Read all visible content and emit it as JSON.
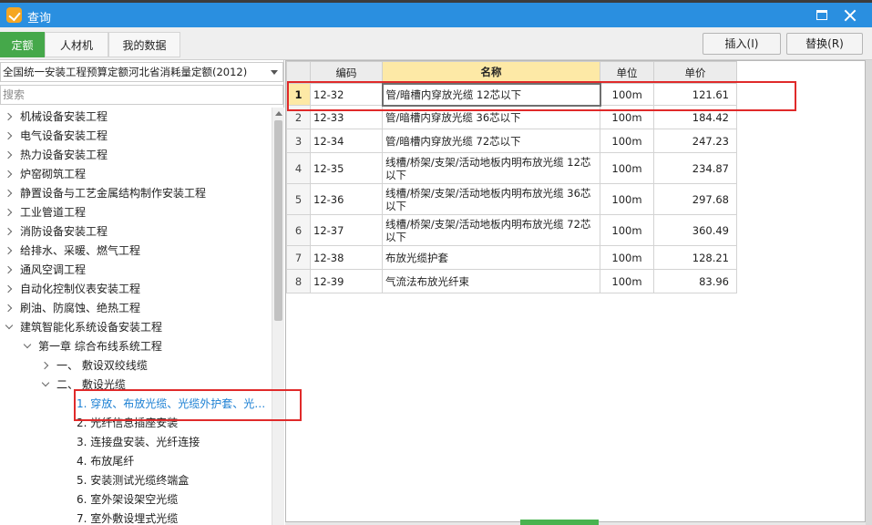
{
  "window": {
    "title": "查询"
  },
  "tabs": [
    {
      "label": "定额",
      "active": true
    },
    {
      "label": "人材机"
    },
    {
      "label": "我的数据"
    }
  ],
  "buttons": {
    "insert": "插入(I)",
    "replace": "替换(R)"
  },
  "quota_library": "全国统一安装工程预算定额河北省消耗量定额(2012)",
  "search": {
    "placeholder": "搜索"
  },
  "tree": [
    {
      "label": "机械设备安装工程",
      "level": 0,
      "expander": "right"
    },
    {
      "label": "电气设备安装工程",
      "level": 0,
      "expander": "right"
    },
    {
      "label": "热力设备安装工程",
      "level": 0,
      "expander": "right"
    },
    {
      "label": "炉窑砌筑工程",
      "level": 0,
      "expander": "right"
    },
    {
      "label": "静置设备与工艺金属结构制作安装工程",
      "level": 0,
      "expander": "right"
    },
    {
      "label": "工业管道工程",
      "level": 0,
      "expander": "right"
    },
    {
      "label": "消防设备安装工程",
      "level": 0,
      "expander": "right"
    },
    {
      "label": "给排水、采暖、燃气工程",
      "level": 0,
      "expander": "right"
    },
    {
      "label": "通风空调工程",
      "level": 0,
      "expander": "right"
    },
    {
      "label": "自动化控制仪表安装工程",
      "level": 0,
      "expander": "right"
    },
    {
      "label": "刷油、防腐蚀、绝热工程",
      "level": 0,
      "expander": "right"
    },
    {
      "label": "建筑智能化系统设备安装工程",
      "level": 0,
      "expander": "down"
    },
    {
      "label": "第一章 综合布线系统工程",
      "level": 1,
      "expander": "down"
    },
    {
      "label": "一、 敷设双绞线缆",
      "level": 2,
      "expander": "right"
    },
    {
      "label": "二、 敷设光缆",
      "level": 2,
      "expander": "down"
    },
    {
      "label": "1.  穿放、布放光缆、光缆外护套、光…",
      "level": 3,
      "expander": "none",
      "selected": true
    },
    {
      "label": "2.  光纤信息插座安装",
      "level": 3,
      "expander": "none"
    },
    {
      "label": "3.  连接盘安装、光纤连接",
      "level": 3,
      "expander": "none"
    },
    {
      "label": "4.  布放尾纤",
      "level": 3,
      "expander": "none"
    },
    {
      "label": "5.  安装测试光缆终端盒",
      "level": 3,
      "expander": "none"
    },
    {
      "label": "6.  室外架设架空光缆",
      "level": 3,
      "expander": "none"
    },
    {
      "label": "7.  室外敷设埋式光缆",
      "level": 3,
      "expander": "none"
    }
  ],
  "table": {
    "headers": [
      "",
      "编码",
      "名称",
      "单位",
      "单价"
    ],
    "rows": [
      {
        "index": "1",
        "code": "12-32",
        "name": "管/暗槽内穿放光缆 12芯以下",
        "unit": "100m",
        "price": "121.61"
      },
      {
        "index": "2",
        "code": "12-33",
        "name": "管/暗槽内穿放光缆 36芯以下",
        "unit": "100m",
        "price": "184.42"
      },
      {
        "index": "3",
        "code": "12-34",
        "name": "管/暗槽内穿放光缆 72芯以下",
        "unit": "100m",
        "price": "247.23"
      },
      {
        "index": "4",
        "code": "12-35",
        "name": "线槽/桥架/支架/活动地板内明布放光缆 12芯以下",
        "unit": "100m",
        "price": "234.87"
      },
      {
        "index": "5",
        "code": "12-36",
        "name": "线槽/桥架/支架/活动地板内明布放光缆 36芯以下",
        "unit": "100m",
        "price": "297.68"
      },
      {
        "index": "6",
        "code": "12-37",
        "name": "线槽/桥架/支架/活动地板内明布放光缆 72芯以下",
        "unit": "100m",
        "price": "360.49"
      },
      {
        "index": "7",
        "code": "12-38",
        "name": "布放光缆护套",
        "unit": "100m",
        "price": "128.21"
      },
      {
        "index": "8",
        "code": "12-39",
        "name": "气流法布放光纤束",
        "unit": "100m",
        "price": "83.96"
      }
    ]
  },
  "colors": {
    "titlebar": "#2a8fe0",
    "active_tab": "#45a84a",
    "header_highlight": "#fde9a6",
    "selected_tree_text": "#1a7fd3",
    "annotation": "#e02a2a"
  }
}
